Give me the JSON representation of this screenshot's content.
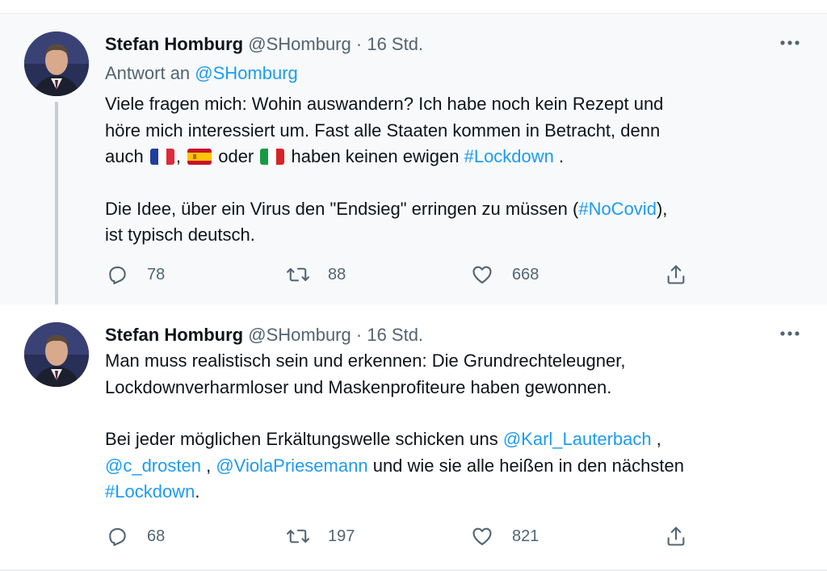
{
  "tweets": [
    {
      "name": "Stefan Homburg",
      "handle": "@SHomburg",
      "separator": "·",
      "time": "16 Std.",
      "reply_prefix": "Antwort an",
      "reply_handle": "@SHomburg",
      "para1_line1": "Viele fragen mich: Wohin auswandern? Ich habe noch kein Rezept und",
      "para1_line2": "höre mich interessiert um. Fast alle Staaten kommen in Betracht, denn",
      "para1_line3_a": "auch",
      "para1_line3_b": ",",
      "para1_line3_c": "oder",
      "para1_line3_d": "haben keinen ewigen",
      "para1_hashtag": "#Lockdown",
      "para1_end": ".",
      "para2_a": "Die Idee, über ein Virus den \"Endsieg\" erringen zu müssen (",
      "para2_hashtag": "#NoCovid",
      "para2_b": "),",
      "para2_line2": "ist typisch deutsch.",
      "replies": "78",
      "retweets": "88",
      "likes": "668"
    },
    {
      "name": "Stefan Homburg",
      "handle": "@SHomburg",
      "separator": "·",
      "time": "16 Std.",
      "para1_line1": "Man muss realistisch sein und erkennen: Die Grundrechteleugner,",
      "para1_line2": "Lockdownverharmloser und Maskenprofiteure haben gewonnen.",
      "para2_a": "Bei jeder möglichen Erkältungswelle schicken uns",
      "mention1": "@Karl_Lauterbach",
      "comma1": ",",
      "mention2": "@c_drosten",
      "comma2": ",",
      "mention3": "@ViolaPriesemann",
      "para2_b": "und wie sie alle heißen in den nächsten",
      "hashtag": "#Lockdown",
      "para2_end": ".",
      "replies": "68",
      "retweets": "197",
      "likes": "821"
    }
  ],
  "icons": {
    "more": "more-horizontal-icon",
    "reply": "reply-icon",
    "retweet": "retweet-icon",
    "like": "heart-icon",
    "share": "share-icon"
  },
  "colors": {
    "link": "#1d9bf0",
    "secondary_text": "#536471",
    "thread_line": "#c4cfd6",
    "highlight_bg": "#f7f9fa"
  }
}
